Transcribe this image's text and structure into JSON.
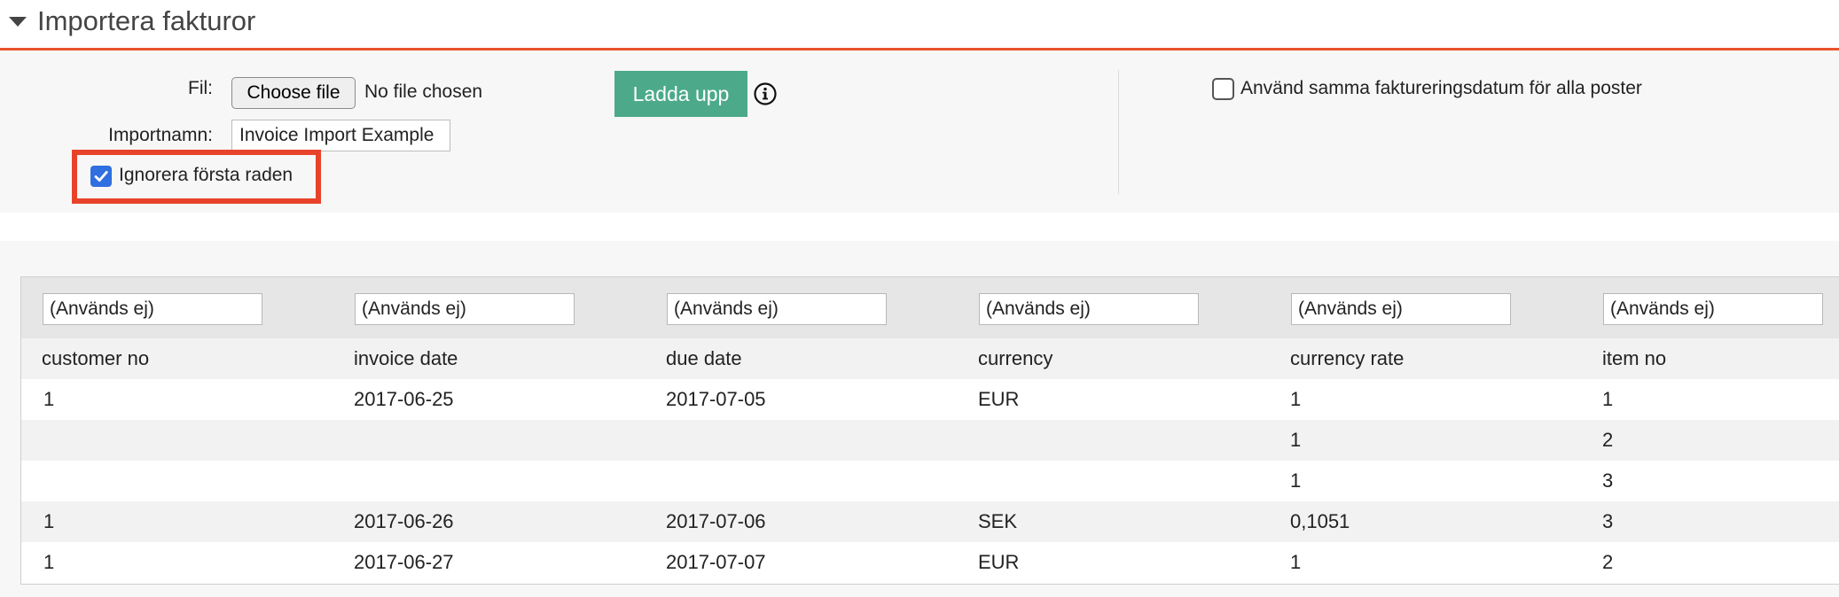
{
  "header": {
    "title": "Importera fakturor"
  },
  "form": {
    "file_label": "Fil:",
    "choose_file_label": "Choose file",
    "file_status": "No file chosen",
    "upload_label": "Ladda upp",
    "import_name_label": "Importnamn:",
    "import_name_value": "Invoice Import Example",
    "ignore_first_row_label": "Ignorera första raden",
    "ignore_first_row_checked": true,
    "same_date_label": "Använd samma faktureringsdatum för alla poster",
    "same_date_checked": false
  },
  "table": {
    "mapping": [
      "(Används ej)",
      "(Används ej)",
      "(Används ej)",
      "(Används ej)",
      "(Används ej)",
      "(Används ej)"
    ],
    "headers": [
      "customer no",
      "invoice date",
      "due date",
      "currency",
      "currency rate",
      "item no"
    ],
    "rows": [
      [
        "1",
        "2017-06-25",
        "2017-07-05",
        "EUR",
        "1",
        "1"
      ],
      [
        "",
        "",
        "",
        "",
        "1",
        "2"
      ],
      [
        "",
        "",
        "",
        "",
        "1",
        "3"
      ],
      [
        "1",
        "2017-06-26",
        "2017-07-06",
        "SEK",
        "0,1051",
        "3"
      ],
      [
        "1",
        "2017-06-27",
        "2017-07-07",
        "EUR",
        "1",
        "2"
      ]
    ]
  },
  "colors": {
    "accent": "#e8532f",
    "upload": "#4caa8a",
    "checkbox": "#2f6fe0",
    "highlight": "#e8432a"
  }
}
